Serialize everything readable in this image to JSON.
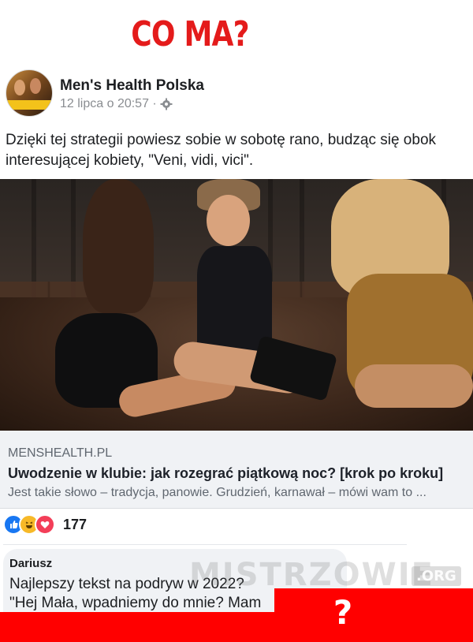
{
  "headline": "CO MA?",
  "post": {
    "page_name": "Men's Health Polska",
    "date": "12 lipca o 20:57 ·",
    "privacy_icon": "gear-icon",
    "text": "Dzięki tej strategii powiesz sobie w sobotę rano, budząc się obok interesującej kobiety, \"Veni, vidi, vici\"."
  },
  "link": {
    "domain": "MENSHEALTH.PL",
    "title": "Uwodzenie w klubie: jak rozegrać piątkową noc? [krok po kroku]",
    "description": "Jest takie słowo – tradycja, panowie. Grudzień, karnawał – mówi wam to ..."
  },
  "reactions": {
    "icons": [
      "like-icon",
      "haha-icon",
      "love-icon"
    ],
    "count": "177"
  },
  "comment": {
    "author": "Dariusz",
    "line1": "Najlepszy tekst na podryw w 2022?",
    "line2": "\"Hej Mała, wpadniemy do mnie? Mam"
  },
  "watermark": {
    "text": "MISTRZOWIE",
    "suffix": ".ORG"
  },
  "overlay_mark": "?",
  "colors": {
    "headline": "#e41b1b",
    "overlay_red": "#ff0000",
    "like_blue": "#1877f2",
    "haha_yellow": "#f7b928",
    "love_red": "#f33e58"
  }
}
